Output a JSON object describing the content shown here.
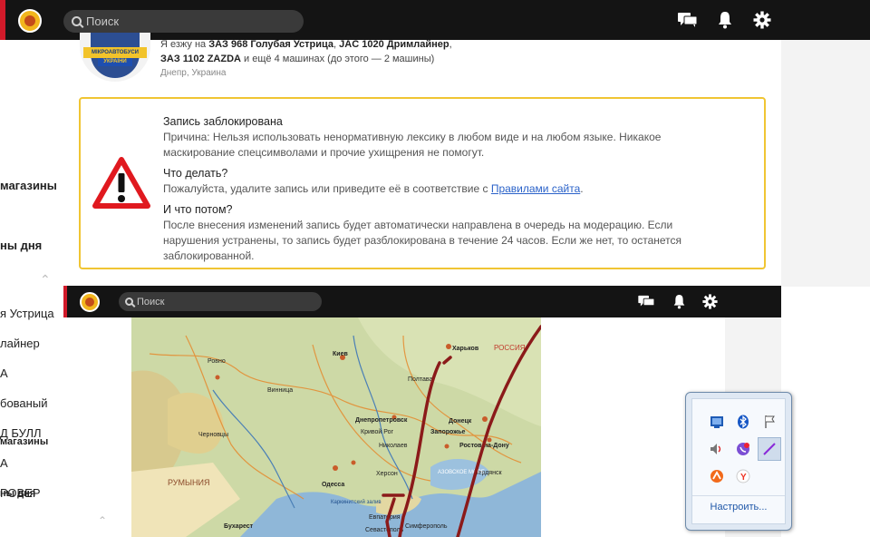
{
  "topbar": {
    "search_placeholder": "Поиск",
    "icons": [
      "messages-icon",
      "bell-icon",
      "gear-icon"
    ]
  },
  "sidebar": {
    "items": [
      {
        "label": "магазины"
      },
      {
        "label": "ны дня"
      },
      {
        "label": "я Устрица"
      },
      {
        "label": "лайнер"
      },
      {
        "label": "А"
      },
      {
        "label": "бованый"
      },
      {
        "label": "Д БУЛЛ"
      },
      {
        "label": "А"
      },
      {
        "label": "РОВЕР"
      }
    ],
    "items2": [
      {
        "label": "магазины"
      },
      {
        "label": "ны дня"
      }
    ]
  },
  "profile": {
    "badge_text": "МІКРОАВТОБУСИ",
    "badge_text2": "УКРАЇНИ",
    "line1_prefix": "Я езжу на ",
    "car1": "ЗАЗ 968 Голубая Устрица",
    "sep1": ", ",
    "car2": "JAC 1020 Дримлайнер",
    "sep2": ",",
    "car3": "ЗАЗ 1102 ZAZDA",
    "line2_suffix": " и ещё 4 машинах (до этого — 2 машины)",
    "location": "Днепр, Украина"
  },
  "notice": {
    "title": "Запись заблокирована",
    "reason": "Причина: Нельзя использовать ненормативную лексику в любом виде и на любом языке. Никакое маскирование спецсимволами и прочие ухищрения не помогут.",
    "todo_title": "Что делать?",
    "todo_text": "Пожалуйста, удалите запись или приведите её в соответствие с ",
    "todo_link": "Правилами сайта",
    "todo_end": ".",
    "next_title": "И что потом?",
    "next_text": "После внесения изменений запись будет автоматически направлена в очередь на модерацию. Если нарушения устранены, то запись будет разблокирована в течение 24 часов. Если же нет, то останется заблокированной."
  },
  "map": {
    "labels": [
      "Киев",
      "Харьков",
      "Ровно",
      "Черновцы",
      "Винница",
      "Полтава",
      "Днепропетровск",
      "Запорожье",
      "Донецк",
      "Кривой Рог",
      "Николаев",
      "Херсон",
      "Одесса",
      "Ростов-на-Дону",
      "Бердянск",
      "Евпатория",
      "Симферополь",
      "Севастополь",
      "АЗОВСКОЕ МОРЕ",
      "РУМЫНИЯ",
      "РОССИЯ",
      "Каркинитский залив",
      "Бухарест"
    ],
    "colors": {
      "land": "#c9d6a0",
      "sea": "#8fb7d8",
      "route": "#8b1a1a"
    }
  },
  "tray": {
    "icons": [
      "network-icon",
      "bluetooth-icon",
      "flag-icon",
      "volume-icon",
      "viber-icon",
      "pen-icon",
      "avast-icon",
      "yandex-icon"
    ],
    "configure": "Настроить..."
  }
}
